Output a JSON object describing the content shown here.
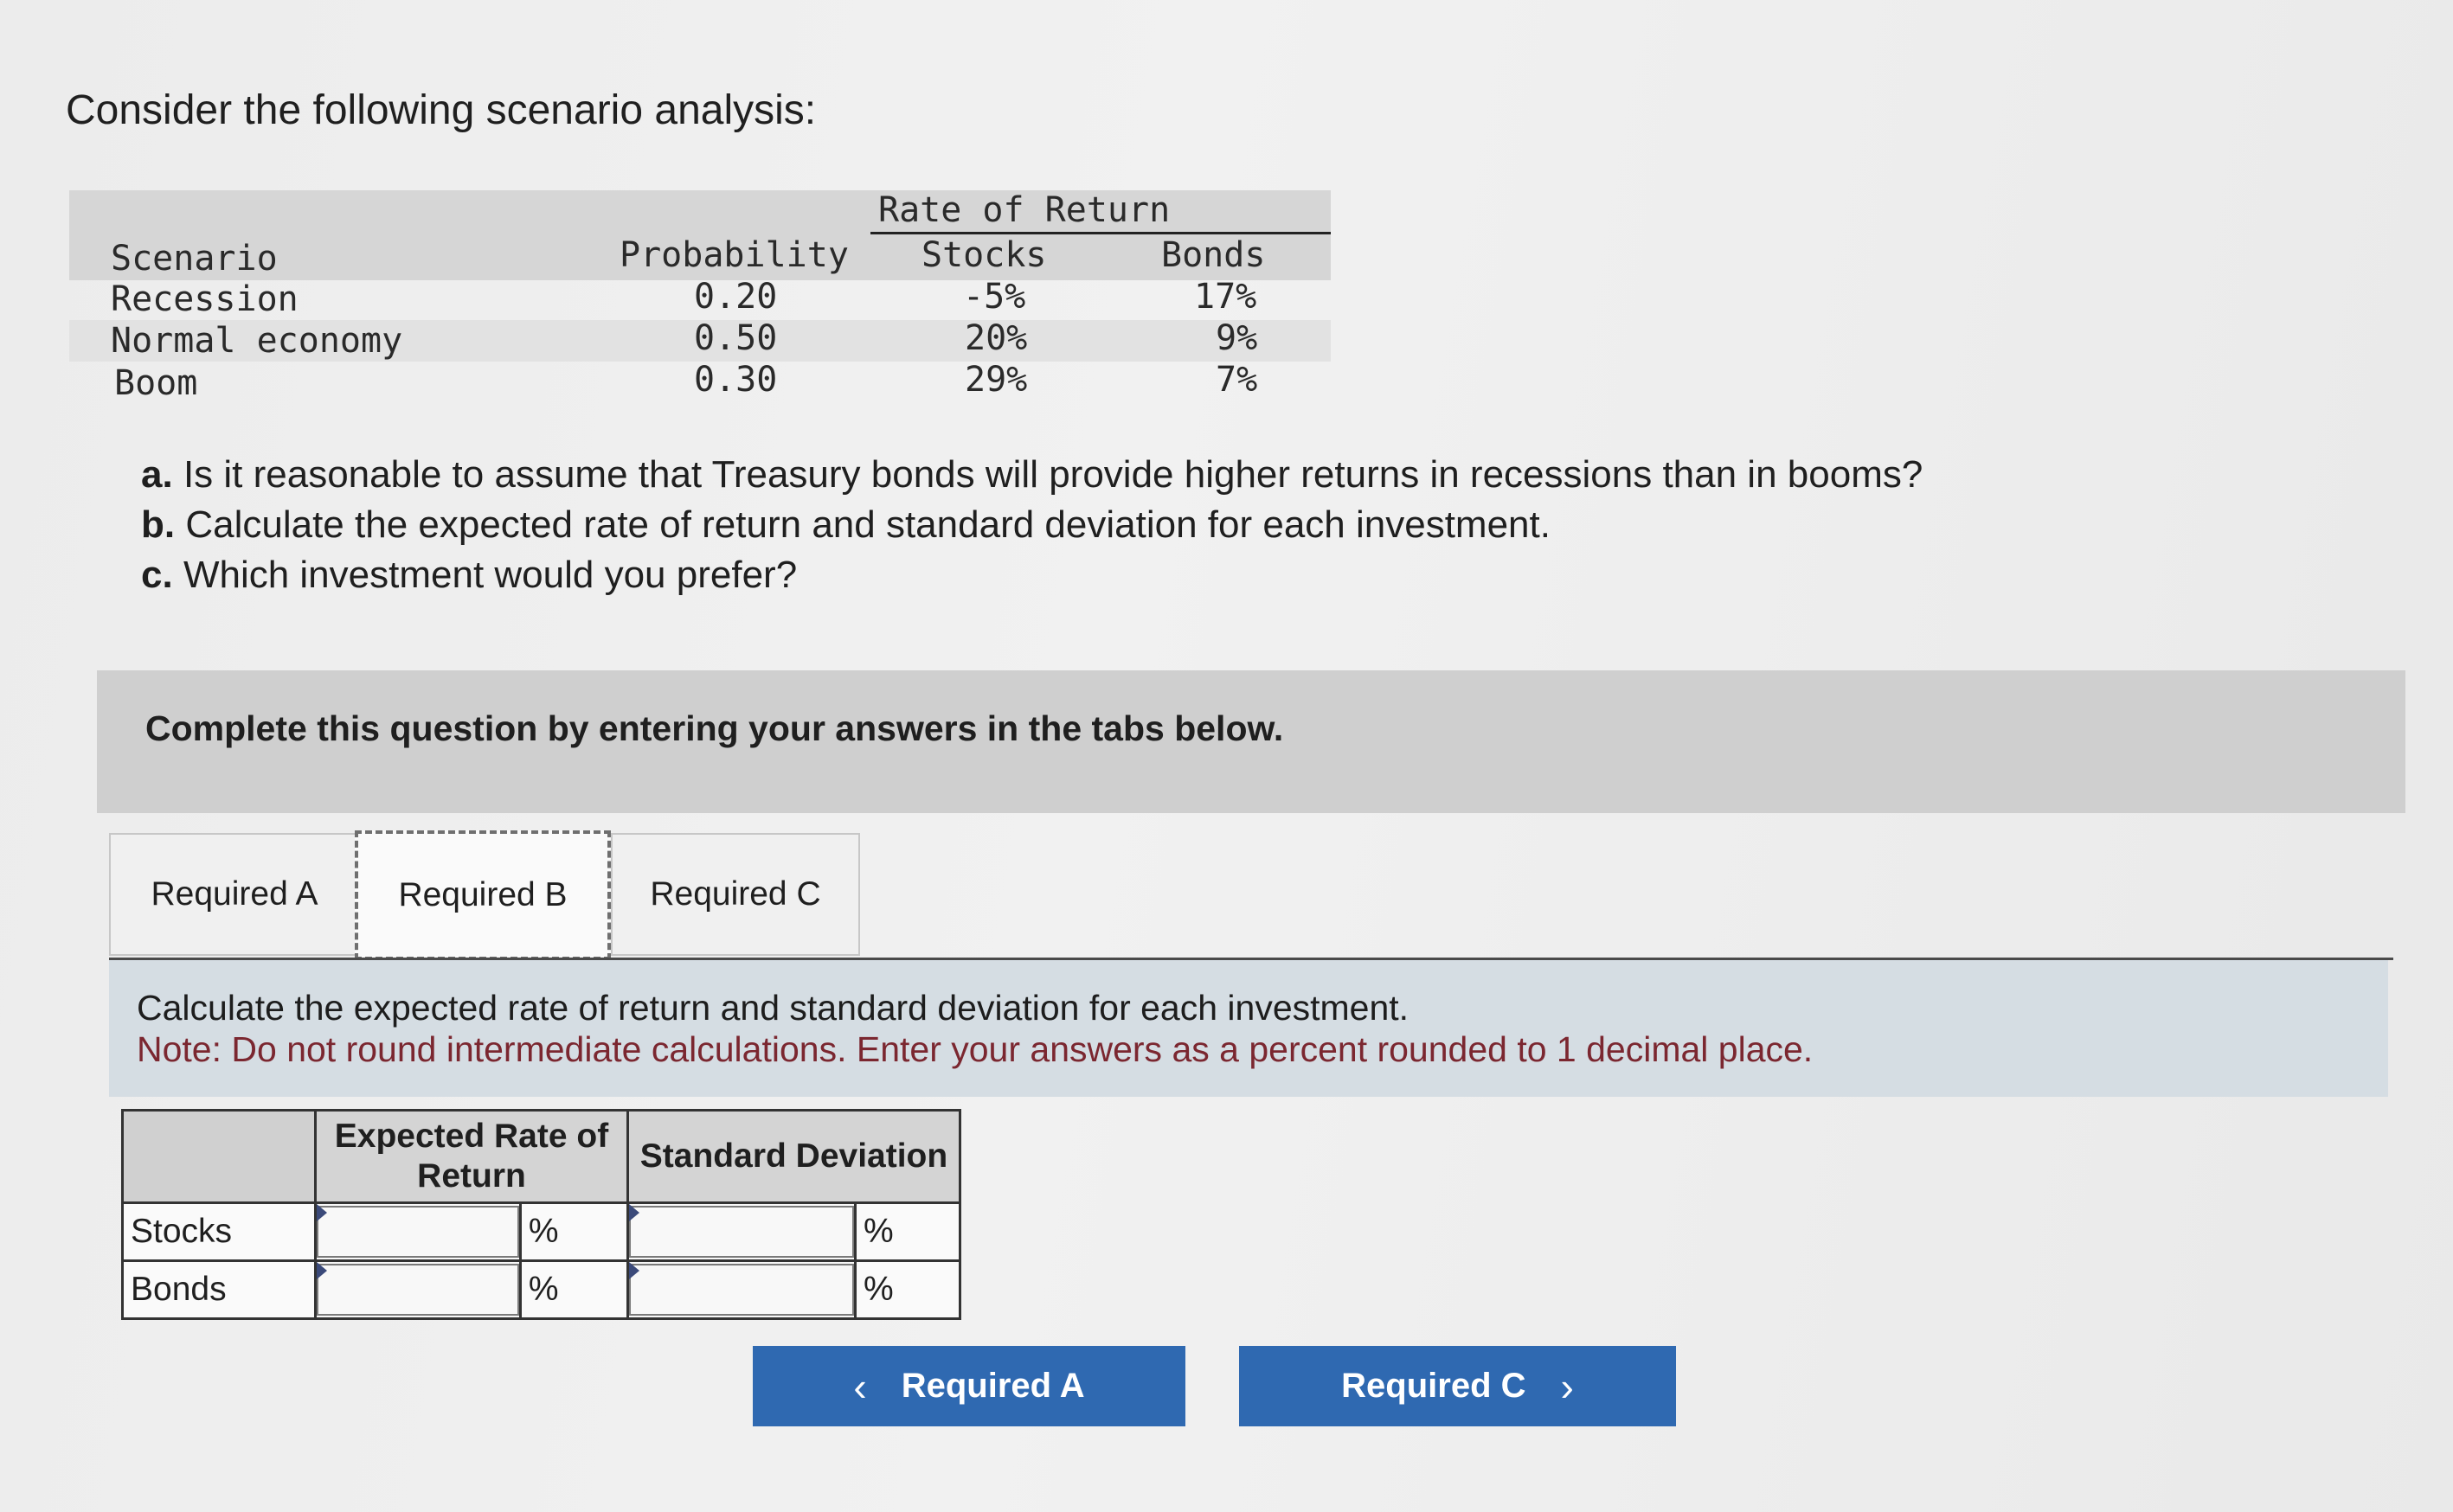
{
  "intro": "Consider the following scenario analysis:",
  "scenario_table": {
    "group_header": "Rate of Return",
    "headers": {
      "scenario": "Scenario",
      "probability": "Probability",
      "stocks": "Stocks",
      "bonds": "Bonds"
    },
    "rows": [
      {
        "scenario": "Recession",
        "probability": "0.20",
        "stocks": "-5%",
        "bonds": "17%"
      },
      {
        "scenario": "Normal economy",
        "probability": "0.50",
        "stocks": "20%",
        "bonds": "9%"
      },
      {
        "scenario": "Boom",
        "probability": "0.30",
        "stocks": "29%",
        "bonds": "7%"
      }
    ]
  },
  "questions": [
    {
      "label": "a.",
      "text": "Is it reasonable to assume that Treasury bonds will provide higher returns in recessions than in booms?"
    },
    {
      "label": "b.",
      "text": "Calculate the expected rate of return and standard deviation for each investment."
    },
    {
      "label": "c.",
      "text": "Which investment would you prefer?"
    }
  ],
  "banner": "Complete this question by entering your answers in the tabs below.",
  "tabs": [
    {
      "label": "Required A",
      "active": false
    },
    {
      "label": "Required B",
      "active": true
    },
    {
      "label": "Required C",
      "active": false
    }
  ],
  "instructions": {
    "line1": "Calculate the expected rate of return and standard deviation for each investment.",
    "line2": "Note: Do not round intermediate calculations. Enter your answers as a percent rounded to 1 decimal place."
  },
  "answer_table": {
    "headers": {
      "expected": "Expected Rate of Return",
      "stdev": "Standard Deviation"
    },
    "rows": [
      {
        "label": "Stocks",
        "expected_value": "",
        "expected_unit": "%",
        "stdev_value": "",
        "stdev_unit": "%"
      },
      {
        "label": "Bonds",
        "expected_value": "",
        "expected_unit": "%",
        "stdev_value": "",
        "stdev_unit": "%"
      }
    ]
  },
  "nav": {
    "prev_label": "Required A",
    "next_label": "Required C",
    "prev_icon": "chevron-left-icon",
    "next_icon": "chevron-right-icon",
    "button_color": "#2f69b1"
  }
}
